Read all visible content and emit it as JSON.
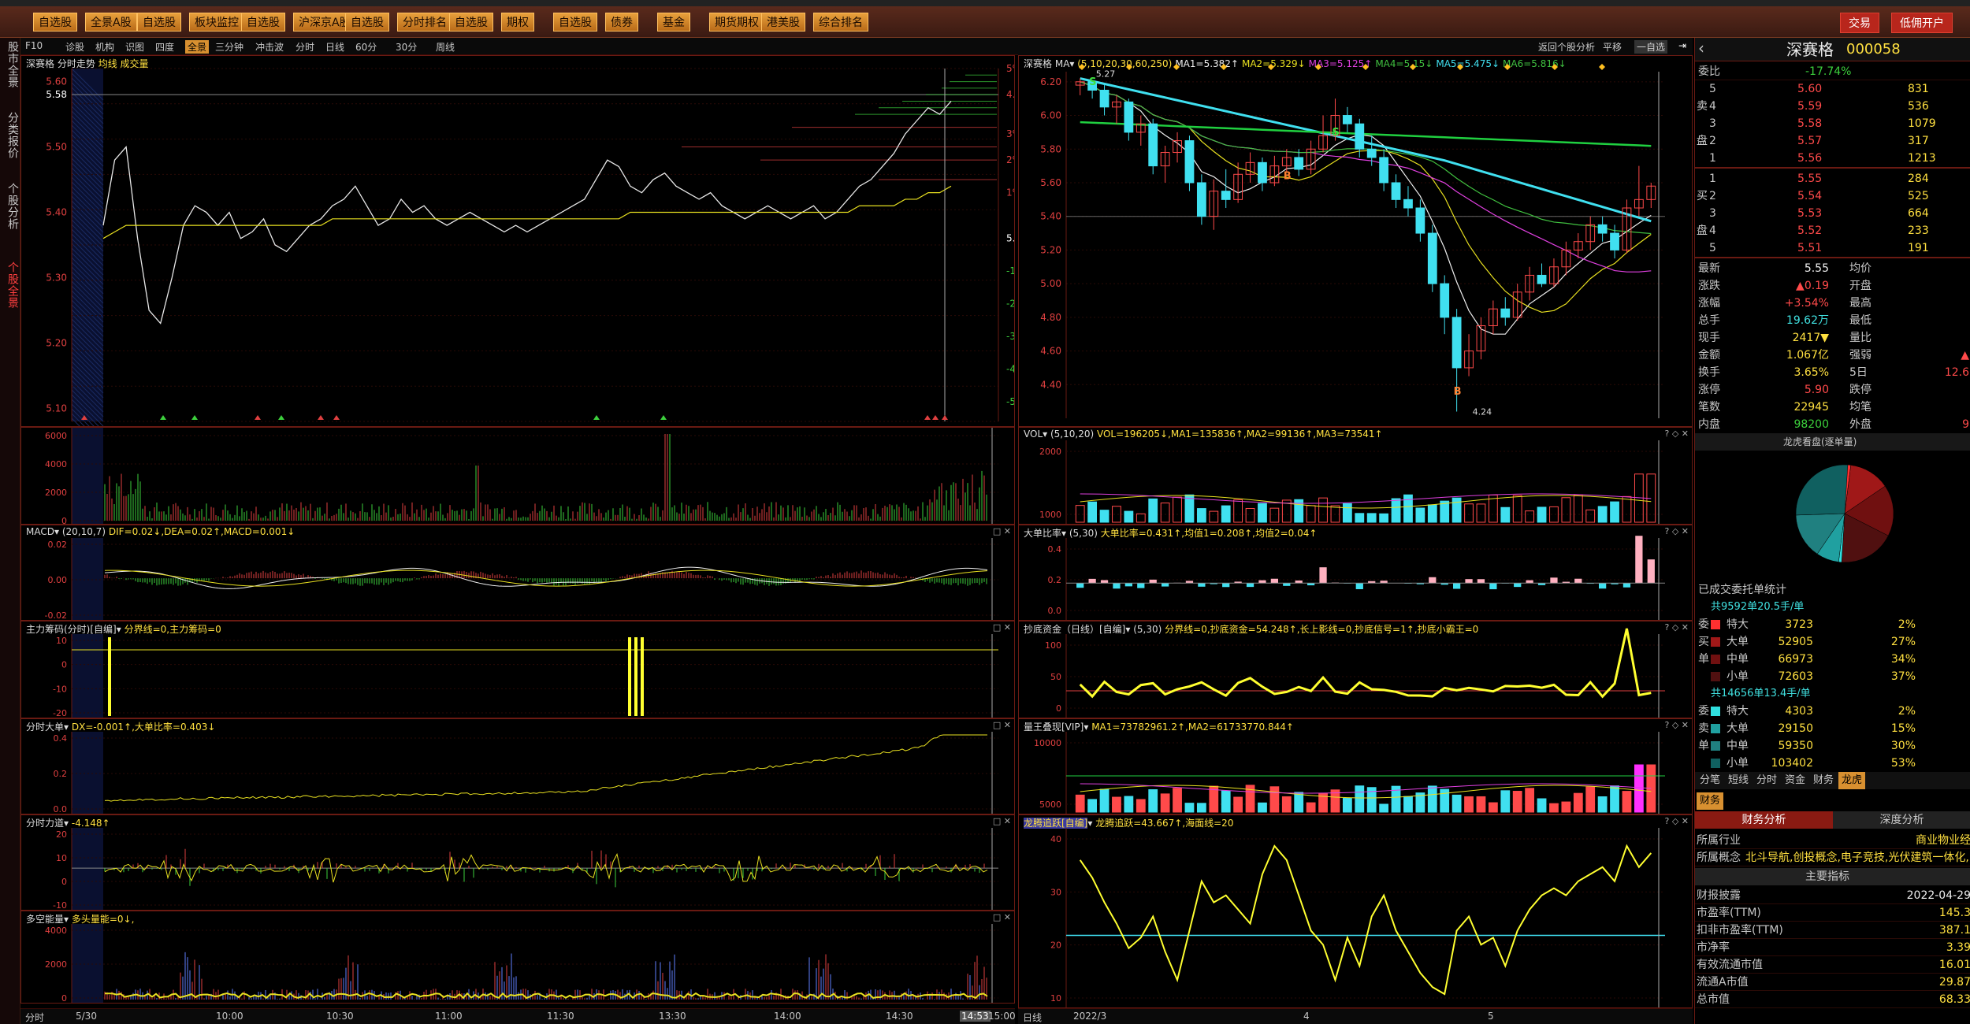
{
  "toolbar": {
    "buttons": [
      "自选股",
      "全景A股",
      "自选股",
      "板块监控",
      "自选股",
      "沪深京A股",
      "自选股",
      "分时排名",
      "自选股",
      "期权",
      "自选股",
      "债券",
      "基金",
      "期货期权",
      "港美股",
      "综合排名"
    ],
    "right_buttons": [
      "交易",
      "低佣开户"
    ]
  },
  "leftnav": [
    "股市全景",
    "分类报价",
    "个股分析",
    "个股全景"
  ],
  "left_toolbar": [
    "F10",
    "诊股",
    "机构",
    "识图",
    "四度",
    "全景",
    "三分钟",
    "冲击波",
    "分时",
    "日线",
    "60分",
    "30分",
    "周线"
  ],
  "stock": {
    "name": "深赛格",
    "code": "000058"
  },
  "intraday": {
    "title": "分时走势",
    "sub": "均线  成交量",
    "yticks": [
      "5.60",
      "5.58",
      "5.50",
      "5.40",
      "5.30",
      "5.20",
      "5.10"
    ],
    "pct": [
      "5%",
      "4.1%",
      "3%",
      "2%",
      "1%",
      "5.36",
      "-1%",
      "-2%",
      "-3%",
      "-4%",
      "-5%"
    ],
    "prices": [
      5.38,
      5.48,
      5.5,
      5.36,
      5.25,
      5.23,
      5.3,
      5.38,
      5.41,
      5.4,
      5.38,
      5.4,
      5.36,
      5.37,
      5.39,
      5.35,
      5.34,
      5.36,
      5.38,
      5.39,
      5.41,
      5.42,
      5.44,
      5.41,
      5.38,
      5.39,
      5.42,
      5.4,
      5.41,
      5.39,
      5.38,
      5.39,
      5.4,
      5.39,
      5.38,
      5.37,
      5.38,
      5.37,
      5.38,
      5.39,
      5.4,
      5.41,
      5.42,
      5.45,
      5.48,
      5.47,
      5.44,
      5.43,
      5.45,
      5.46,
      5.44,
      5.43,
      5.42,
      5.43,
      5.41,
      5.4,
      5.39,
      5.4,
      5.41,
      5.4,
      5.39,
      5.4,
      5.41,
      5.39,
      5.4,
      5.42,
      5.44,
      5.45,
      5.47,
      5.49,
      5.52,
      5.54,
      5.56,
      5.55,
      5.57
    ],
    "avg": [
      5.36,
      5.37,
      5.38,
      5.38,
      5.38,
      5.38,
      5.38,
      5.38,
      5.38,
      5.38,
      5.38,
      5.38,
      5.38,
      5.38,
      5.38,
      5.38,
      5.38,
      5.38,
      5.38,
      5.38,
      5.39,
      5.39,
      5.39,
      5.39,
      5.39,
      5.39,
      5.39,
      5.39,
      5.39,
      5.39,
      5.39,
      5.39,
      5.39,
      5.39,
      5.39,
      5.39,
      5.39,
      5.39,
      5.39,
      5.39,
      5.39,
      5.39,
      5.39,
      5.39,
      5.39,
      5.39,
      5.4,
      5.4,
      5.4,
      5.4,
      5.4,
      5.4,
      5.4,
      5.4,
      5.4,
      5.4,
      5.4,
      5.4,
      5.4,
      5.4,
      5.4,
      5.4,
      5.4,
      5.4,
      5.4,
      5.4,
      5.41,
      5.41,
      5.41,
      5.41,
      5.42,
      5.42,
      5.43,
      5.43,
      5.44
    ],
    "vol_label": [
      "6000",
      "4000",
      "2000",
      "0"
    ],
    "time_labels": [
      "5/30",
      "10:00",
      "10:30",
      "11:00",
      "11:30",
      "13:30",
      "14:00",
      "14:30",
      "14:53",
      "15:00"
    ],
    "bottom_label": "分时"
  },
  "ind_panels": [
    {
      "name": "MACD",
      "params": "(20,10,7)",
      "text": "DIF=0.02↓,DEA=0.02↑,MACD=0.001↓",
      "ticks": [
        "0.02",
        "0.00",
        "-0.02"
      ]
    },
    {
      "name": "主力筹码(分时)[自编]",
      "params": "",
      "text": "分界线=0,主力筹码=0",
      "ticks": [
        "10",
        "0",
        "-10",
        "-20"
      ]
    },
    {
      "name": "分时大单",
      "params": "",
      "text": "DX=-0.001↑,大单比率=0.403↓",
      "ticks": [
        "0.4",
        "0.2",
        "0.0"
      ]
    },
    {
      "name": "分时力道",
      "params": "",
      "text": "-4.148↑",
      "ticks": [
        "20",
        "10",
        "0",
        "-10"
      ]
    },
    {
      "name": "多空能量",
      "params": "",
      "text": "多头量能=0↓,",
      "ticks": [
        "4000",
        "2000",
        "0"
      ]
    }
  ],
  "daily": {
    "title": "MA",
    "params": "(5,10,20,30,60,250)",
    "ma_text": [
      "MA1=5.382↑",
      "MA2=5.329↓",
      "MA3=5.125↑",
      "MA4=5.15↓",
      "MA5=5.475↓",
      "MA6=5.816↓"
    ],
    "yticks": [
      "6.20",
      "6.00",
      "5.80",
      "5.60",
      "5.40",
      "5.20",
      "5.00",
      "4.80",
      "4.60",
      "4.40"
    ],
    "high_label": "5.27",
    "low_label": "4.24",
    "xlabels": [
      "2022/3",
      "4",
      "5"
    ],
    "bottom_label": "日线",
    "candles": [
      [
        6.18,
        6.2,
        6.22,
        6.12
      ],
      [
        6.2,
        6.15,
        6.21,
        6.1
      ],
      [
        6.15,
        6.05,
        6.18,
        6.0
      ],
      [
        6.05,
        6.08,
        6.12,
        5.95
      ],
      [
        6.08,
        5.9,
        6.1,
        5.85
      ],
      [
        5.9,
        5.95,
        6.0,
        5.82
      ],
      [
        5.95,
        5.7,
        5.98,
        5.65
      ],
      [
        5.7,
        5.78,
        5.82,
        5.6
      ],
      [
        5.78,
        5.85,
        5.9,
        5.72
      ],
      [
        5.85,
        5.6,
        5.88,
        5.55
      ],
      [
        5.6,
        5.4,
        5.65,
        5.35
      ],
      [
        5.4,
        5.55,
        5.62,
        5.32
      ],
      [
        5.55,
        5.5,
        5.68,
        5.45
      ],
      [
        5.5,
        5.65,
        5.72,
        5.48
      ],
      [
        5.65,
        5.72,
        5.78,
        5.6
      ],
      [
        5.72,
        5.6,
        5.75,
        5.55
      ],
      [
        5.6,
        5.7,
        5.76,
        5.58
      ],
      [
        5.7,
        5.75,
        5.8,
        5.66
      ],
      [
        5.75,
        5.68,
        5.8,
        5.64
      ],
      [
        5.68,
        5.8,
        5.85,
        5.65
      ],
      [
        5.8,
        5.88,
        6.0,
        5.78
      ],
      [
        5.88,
        6.0,
        6.1,
        5.85
      ],
      [
        6.0,
        5.95,
        6.05,
        5.9
      ],
      [
        5.95,
        5.8,
        5.98,
        5.75
      ],
      [
        5.8,
        5.75,
        5.88,
        5.7
      ],
      [
        5.75,
        5.6,
        5.8,
        5.55
      ],
      [
        5.6,
        5.5,
        5.65,
        5.45
      ],
      [
        5.5,
        5.45,
        5.58,
        5.4
      ],
      [
        5.45,
        5.3,
        5.5,
        5.25
      ],
      [
        5.3,
        5.0,
        5.35,
        4.95
      ],
      [
        5.0,
        4.8,
        5.05,
        4.7
      ],
      [
        4.8,
        4.5,
        4.85,
        4.24
      ],
      [
        4.5,
        4.6,
        4.7,
        4.45
      ],
      [
        4.6,
        4.75,
        4.8,
        4.55
      ],
      [
        4.75,
        4.85,
        4.9,
        4.7
      ],
      [
        4.85,
        4.8,
        4.92,
        4.75
      ],
      [
        4.8,
        4.95,
        5.0,
        4.78
      ],
      [
        4.95,
        5.05,
        5.1,
        4.9
      ],
      [
        5.05,
        5.0,
        5.12,
        4.98
      ],
      [
        5.0,
        5.1,
        5.15,
        4.98
      ],
      [
        5.1,
        5.2,
        5.25,
        5.05
      ],
      [
        5.2,
        5.25,
        5.3,
        5.15
      ],
      [
        5.25,
        5.35,
        5.4,
        5.2
      ],
      [
        5.35,
        5.3,
        5.4,
        5.25
      ],
      [
        5.3,
        5.2,
        5.35,
        5.15
      ],
      [
        5.2,
        5.45,
        5.5,
        5.18
      ],
      [
        5.45,
        5.5,
        5.7,
        5.4
      ],
      [
        5.5,
        5.58,
        5.6,
        5.45
      ]
    ]
  },
  "daily_panels": [
    {
      "name": "VOL",
      "params": "(5,10,20)",
      "text": "VOL=196205↓,MA1=135836↑,MA2=99136↑,MA3=73541↑",
      "ticks": [
        "2000",
        "1000"
      ]
    },
    {
      "name": "大单比率",
      "params": "(5,30)",
      "text": "大单比率=0.431↑,均值1=0.208↑,均值2=0.04↑",
      "ticks": [
        "0.4",
        "0.2",
        "0.0"
      ]
    },
    {
      "name": "抄底资金（日线）[自编]",
      "params": "(5,30)",
      "text": "分界线=0,抄底资金=54.248↑,长上影线=0,抄底信号=1↑,抄底小霸王=0",
      "ticks": [
        "100",
        "50",
        "0"
      ]
    },
    {
      "name": "量王叠现[VIP]",
      "params": "",
      "text": "MA1=73782961.2↑,MA2=61733770.844↑",
      "ticks": [
        "10000",
        "5000"
      ]
    },
    {
      "name": "龙腾追跃[自编]",
      "params": "",
      "text": "龙腾追跃=43.667↑,海面线=20",
      "ticks": [
        "40",
        "30",
        "20",
        "10"
      ]
    }
  ],
  "quote": {
    "weibi_label": "委比",
    "weibi": "-17.74%",
    "sell": [
      [
        "5",
        "5.60",
        "831"
      ],
      [
        "4",
        "5.59",
        "536"
      ],
      [
        "3",
        "5.58",
        "1079"
      ],
      [
        "2",
        "5.57",
        "317"
      ],
      [
        "1",
        "5.56",
        "1213"
      ]
    ],
    "buy": [
      [
        "1",
        "5.55",
        "284"
      ],
      [
        "2",
        "5.54",
        "525"
      ],
      [
        "3",
        "5.53",
        "664"
      ],
      [
        "4",
        "5.52",
        "233"
      ],
      [
        "5",
        "5.51",
        "191"
      ]
    ],
    "sell_label": "卖",
    "buy_label": "买",
    "pan_label": "盘",
    "stats": [
      [
        "最新",
        "5.55",
        "均价",
        ""
      ],
      [
        "涨跌",
        "▲0.19",
        "开盘",
        ""
      ],
      [
        "涨幅",
        "+3.54%",
        "最高",
        ""
      ],
      [
        "总手",
        "19.62万",
        "最低",
        ""
      ],
      [
        "现手",
        "2417▼",
        "量比",
        ""
      ],
      [
        "金额",
        "1.067亿",
        "强弱",
        "▲"
      ],
      [
        "换手",
        "3.65%",
        "5日",
        "12.6"
      ],
      [
        "涨停",
        "5.90",
        "跌停",
        ""
      ],
      [
        "笔数",
        "22945",
        "均笔",
        ""
      ],
      [
        "内盘",
        "98200",
        "外盘",
        "9"
      ]
    ],
    "lhkp": "龙虎看盘(逐单量)",
    "order_stat": "已成交委托单统计",
    "group1_head": "共9592单20.5手/单",
    "group1": [
      [
        "委",
        "特大",
        "3723",
        "2%"
      ],
      [
        "买",
        "大单",
        "52905",
        "27%"
      ],
      [
        "单",
        "中单",
        "66973",
        "34%"
      ],
      [
        "",
        "小单",
        "72603",
        "37%"
      ]
    ],
    "group2_head": "共14656单13.4手/单",
    "group2": [
      [
        "委",
        "特大",
        "4303",
        "2%"
      ],
      [
        "卖",
        "大单",
        "29150",
        "15%"
      ],
      [
        "单",
        "中单",
        "59350",
        "30%"
      ],
      [
        "",
        "小单",
        "103402",
        "53%"
      ]
    ],
    "tabs": [
      "分笔",
      "短线",
      "分时",
      "资金",
      "财务",
      "龙虎"
    ],
    "fin_tab": "财务",
    "fin_subtabs": [
      "财务分析",
      "深度分析"
    ],
    "industry_label": "所属行业",
    "industry": "商业物业经",
    "concept_label": "所属概念",
    "concept": "北斗导航,创投概念,电子竞技,光伏建筑一体化,",
    "main_label": "主要指标",
    "fin": [
      [
        "财报披露",
        "2022-04-29"
      ],
      [
        "市盈率(TTM)",
        "145.3"
      ],
      [
        "扣非市盈率(TTM)",
        "387.1"
      ],
      [
        "市净率",
        "3.39"
      ],
      [
        "有效流通市值",
        "16.01"
      ],
      [
        "流通A市值",
        "29.87"
      ],
      [
        "总市值",
        "68.33"
      ]
    ]
  },
  "right_links": [
    "返回个股分析",
    "平移",
    "一自选"
  ],
  "colors": {
    "up": "#ff4a4a",
    "down": "#3cd03c",
    "ma_cyan": "#40e0f0",
    "ma_green": "#20d040",
    "panel_border": "#6a1a12"
  }
}
